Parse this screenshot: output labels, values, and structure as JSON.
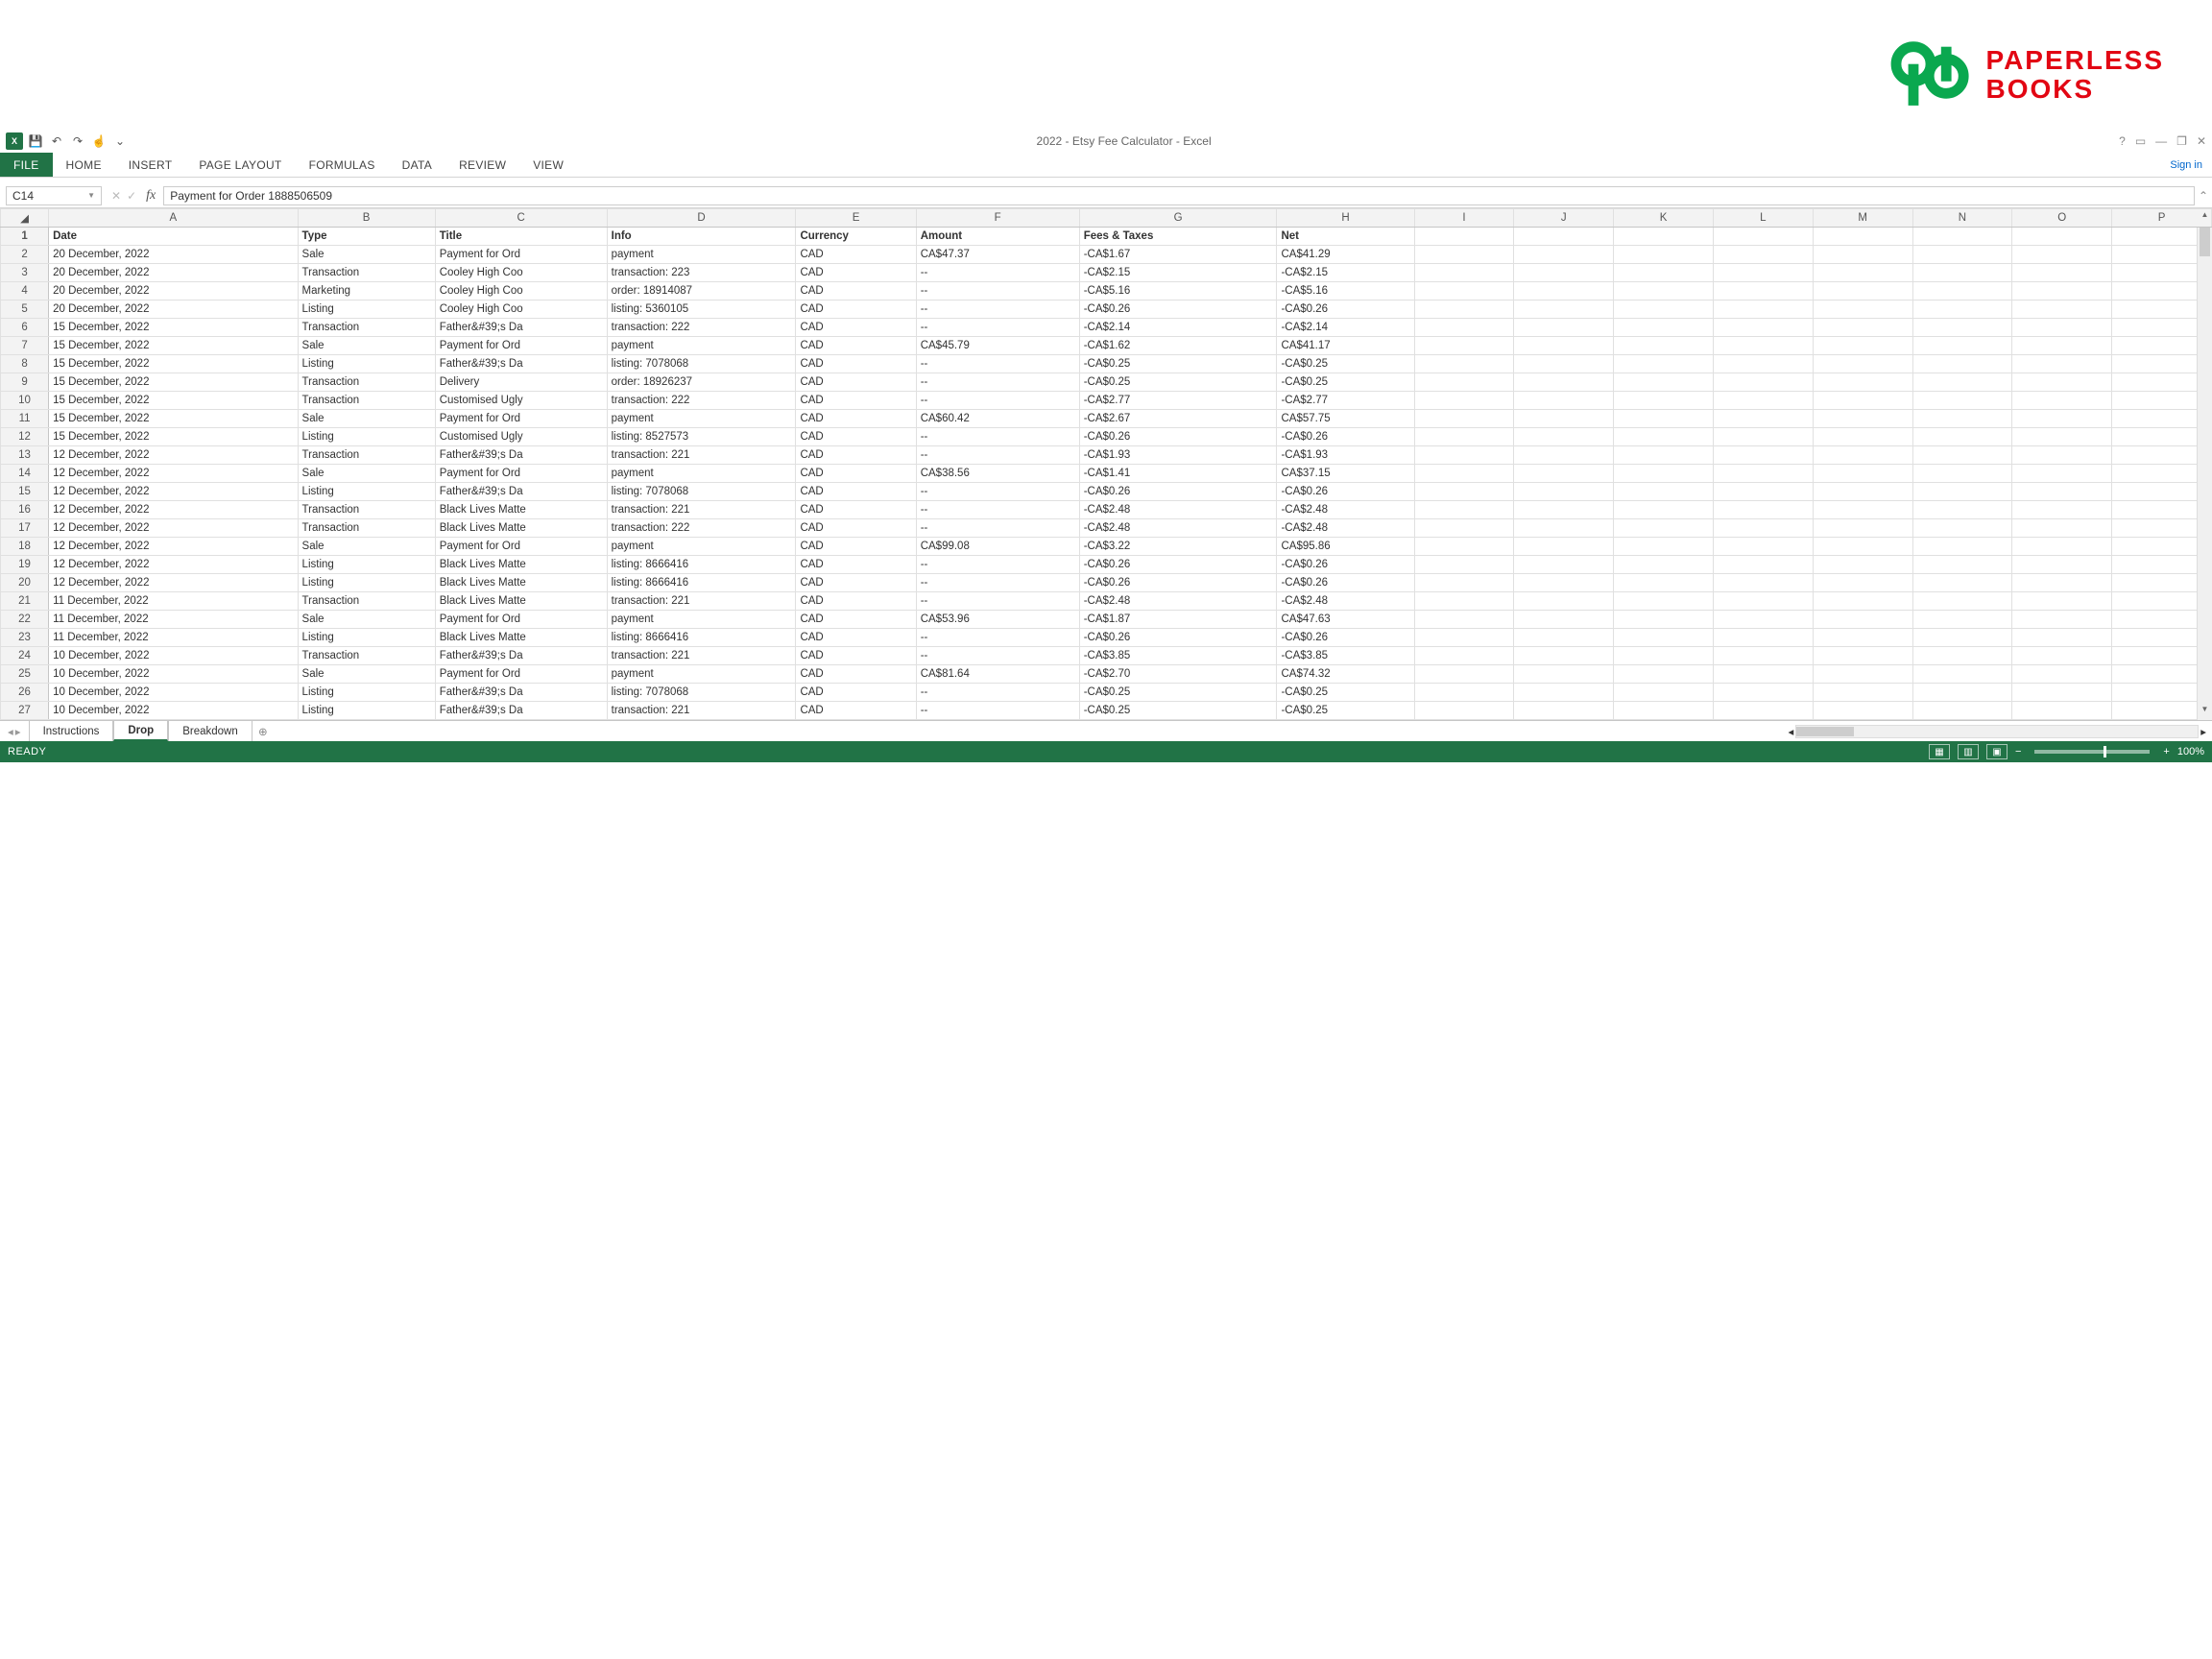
{
  "logo": {
    "line1": "PAPERLESS",
    "line2": "BOOKS"
  },
  "window": {
    "title": "2022 - Etsy Fee Calculator - Excel",
    "signin": "Sign in"
  },
  "qat": {
    "excel_label": "X",
    "save": "💾",
    "undo": "↶",
    "redo": "↷",
    "touch": "☝",
    "custom": "⌄"
  },
  "wincontrols": {
    "help": "?",
    "ribbonopts": "▭",
    "min": "—",
    "restore": "❐",
    "close": "✕"
  },
  "ribbon": {
    "tabs": [
      "FILE",
      "HOME",
      "INSERT",
      "PAGE LAYOUT",
      "FORMULAS",
      "DATA",
      "REVIEW",
      "VIEW"
    ]
  },
  "formula": {
    "cell_ref": "C14",
    "cancel": "✕",
    "enter": "✓",
    "fx": "fx",
    "value": "Payment for Order 1888506509"
  },
  "columns": [
    "A",
    "B",
    "C",
    "D",
    "E",
    "F",
    "G",
    "H",
    "I",
    "J",
    "K",
    "L",
    "M",
    "N",
    "O",
    "P"
  ],
  "headers": {
    "A": "Date",
    "B": "Type",
    "C": "Title",
    "D": "Info",
    "E": "Currency",
    "F": "Amount",
    "G": "Fees & Taxes",
    "H": "Net"
  },
  "rows": [
    {
      "n": 2,
      "A": "20 December, 2022",
      "B": "Sale",
      "C": "Payment for Ord",
      "D": "payment",
      "E": "CAD",
      "F": "CA$47.37",
      "G": "-CA$1.67",
      "H": "CA$41.29"
    },
    {
      "n": 3,
      "A": "20 December, 2022",
      "B": "Transaction",
      "C": "Cooley High Coo",
      "D": "transaction: 223",
      "E": "CAD",
      "F": "--",
      "G": "-CA$2.15",
      "H": "-CA$2.15"
    },
    {
      "n": 4,
      "A": "20 December, 2022",
      "B": "Marketing",
      "C": "Cooley High Coo",
      "D": "order: 18914087",
      "E": "CAD",
      "F": "--",
      "G": "-CA$5.16",
      "H": "-CA$5.16"
    },
    {
      "n": 5,
      "A": "20 December, 2022",
      "B": "Listing",
      "C": "Cooley High Coo",
      "D": "listing: 5360105",
      "E": "CAD",
      "F": "--",
      "G": "-CA$0.26",
      "H": "-CA$0.26"
    },
    {
      "n": 6,
      "A": "15 December, 2022",
      "B": "Transaction",
      "C": "Father&#39;s Da",
      "D": "transaction: 222",
      "E": "CAD",
      "F": "--",
      "G": "-CA$2.14",
      "H": "-CA$2.14"
    },
    {
      "n": 7,
      "A": "15 December, 2022",
      "B": "Sale",
      "C": "Payment for Ord",
      "D": "payment",
      "E": "CAD",
      "F": "CA$45.79",
      "G": "-CA$1.62",
      "H": "CA$41.17"
    },
    {
      "n": 8,
      "A": "15 December, 2022",
      "B": "Listing",
      "C": "Father&#39;s Da",
      "D": "listing: 7078068",
      "E": "CAD",
      "F": "--",
      "G": "-CA$0.25",
      "H": "-CA$0.25"
    },
    {
      "n": 9,
      "A": "15 December, 2022",
      "B": "Transaction",
      "C": "Delivery",
      "D": "order: 18926237",
      "E": "CAD",
      "F": "--",
      "G": "-CA$0.25",
      "H": "-CA$0.25"
    },
    {
      "n": 10,
      "A": "15 December, 2022",
      "B": "Transaction",
      "C": "Customised Ugly",
      "D": "transaction: 222",
      "E": "CAD",
      "F": "--",
      "G": "-CA$2.77",
      "H": "-CA$2.77"
    },
    {
      "n": 11,
      "A": "15 December, 2022",
      "B": "Sale",
      "C": "Payment for Ord",
      "D": "payment",
      "E": "CAD",
      "F": "CA$60.42",
      "G": "-CA$2.67",
      "H": "CA$57.75"
    },
    {
      "n": 12,
      "A": "15 December, 2022",
      "B": "Listing",
      "C": "Customised Ugly",
      "D": "listing: 8527573",
      "E": "CAD",
      "F": "--",
      "G": "-CA$0.26",
      "H": "-CA$0.26"
    },
    {
      "n": 13,
      "A": "12 December, 2022",
      "B": "Transaction",
      "C": "Father&#39;s Da",
      "D": "transaction: 221",
      "E": "CAD",
      "F": "--",
      "G": "-CA$1.93",
      "H": "-CA$1.93"
    },
    {
      "n": 14,
      "A": "12 December, 2022",
      "B": "Sale",
      "C": "Payment for Ord",
      "D": "payment",
      "E": "CAD",
      "F": "CA$38.56",
      "G": "-CA$1.41",
      "H": "CA$37.15"
    },
    {
      "n": 15,
      "A": "12 December, 2022",
      "B": "Listing",
      "C": "Father&#39;s Da",
      "D": "listing: 7078068",
      "E": "CAD",
      "F": "--",
      "G": "-CA$0.26",
      "H": "-CA$0.26"
    },
    {
      "n": 16,
      "A": "12 December, 2022",
      "B": "Transaction",
      "C": "Black Lives Matte",
      "D": "transaction: 221",
      "E": "CAD",
      "F": "--",
      "G": "-CA$2.48",
      "H": "-CA$2.48"
    },
    {
      "n": 17,
      "A": "12 December, 2022",
      "B": "Transaction",
      "C": "Black Lives Matte",
      "D": "transaction: 222",
      "E": "CAD",
      "F": "--",
      "G": "-CA$2.48",
      "H": "-CA$2.48"
    },
    {
      "n": 18,
      "A": "12 December, 2022",
      "B": "Sale",
      "C": "Payment for Ord",
      "D": "payment",
      "E": "CAD",
      "F": "CA$99.08",
      "G": "-CA$3.22",
      "H": "CA$95.86"
    },
    {
      "n": 19,
      "A": "12 December, 2022",
      "B": "Listing",
      "C": "Black Lives Matte",
      "D": "listing: 8666416",
      "E": "CAD",
      "F": "--",
      "G": "-CA$0.26",
      "H": "-CA$0.26"
    },
    {
      "n": 20,
      "A": "12 December, 2022",
      "B": "Listing",
      "C": "Black Lives Matte",
      "D": "listing: 8666416",
      "E": "CAD",
      "F": "--",
      "G": "-CA$0.26",
      "H": "-CA$0.26"
    },
    {
      "n": 21,
      "A": "11 December, 2022",
      "B": "Transaction",
      "C": "Black Lives Matte",
      "D": "transaction: 221",
      "E": "CAD",
      "F": "--",
      "G": "-CA$2.48",
      "H": "-CA$2.48"
    },
    {
      "n": 22,
      "A": "11 December, 2022",
      "B": "Sale",
      "C": "Payment for Ord",
      "D": "payment",
      "E": "CAD",
      "F": "CA$53.96",
      "G": "-CA$1.87",
      "H": "CA$47.63"
    },
    {
      "n": 23,
      "A": "11 December, 2022",
      "B": "Listing",
      "C": "Black Lives Matte",
      "D": "listing: 8666416",
      "E": "CAD",
      "F": "--",
      "G": "-CA$0.26",
      "H": "-CA$0.26"
    },
    {
      "n": 24,
      "A": "10 December, 2022",
      "B": "Transaction",
      "C": "Father&#39;s Da",
      "D": "transaction: 221",
      "E": "CAD",
      "F": "--",
      "G": "-CA$3.85",
      "H": "-CA$3.85"
    },
    {
      "n": 25,
      "A": "10 December, 2022",
      "B": "Sale",
      "C": "Payment for Ord",
      "D": "payment",
      "E": "CAD",
      "F": "CA$81.64",
      "G": "-CA$2.70",
      "H": "CA$74.32"
    },
    {
      "n": 26,
      "A": "10 December, 2022",
      "B": "Listing",
      "C": "Father&#39;s Da",
      "D": "listing: 7078068",
      "E": "CAD",
      "F": "--",
      "G": "-CA$0.25",
      "H": "-CA$0.25"
    },
    {
      "n": 27,
      "A": "10 December, 2022",
      "B": "Listing",
      "C": "Father&#39;s Da",
      "D": "transaction: 221",
      "E": "CAD",
      "F": "--",
      "G": "-CA$0.25",
      "H": "-CA$0.25"
    }
  ],
  "sheets": {
    "nav_prev": "◂",
    "nav_next": "▸",
    "tabs": [
      "Instructions",
      "Drop",
      "Breakdown"
    ],
    "active": "Drop",
    "add": "⊕"
  },
  "status": {
    "ready": "READY",
    "zoom": "100%",
    "minus": "−",
    "plus": "+"
  }
}
